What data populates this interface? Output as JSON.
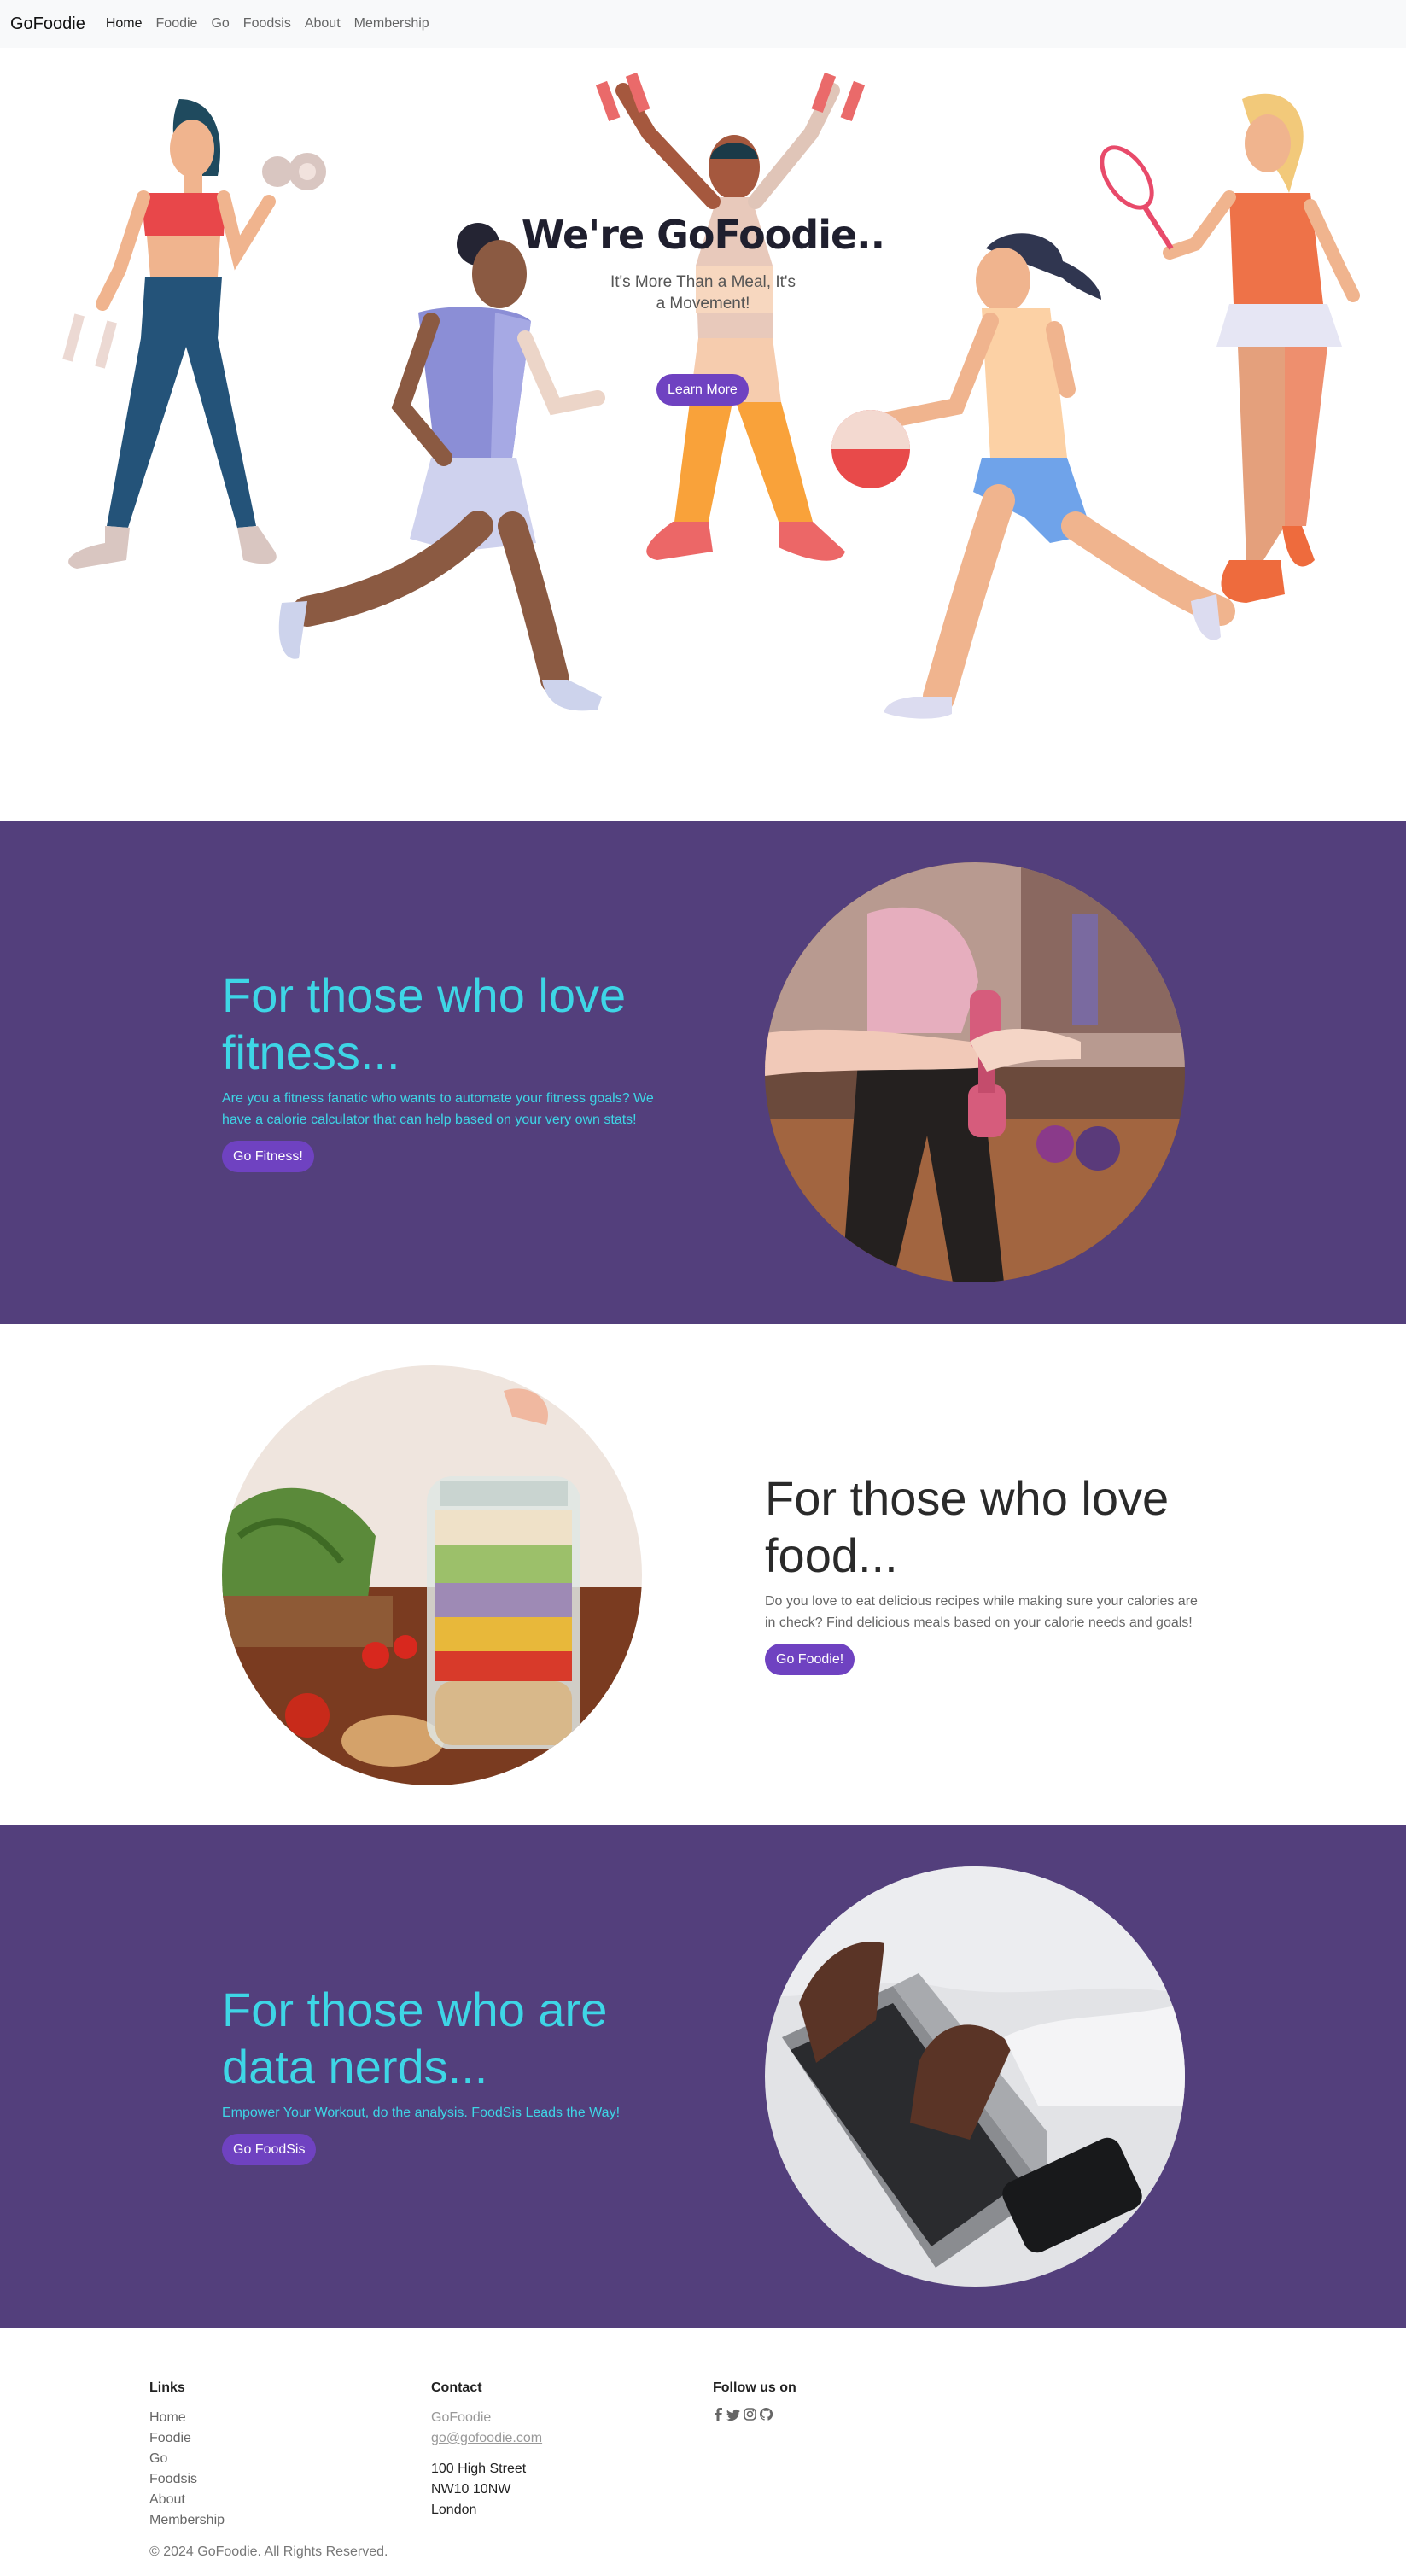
{
  "nav": {
    "brand": "GoFoodie",
    "links": [
      "Home",
      "Foodie",
      "Go",
      "Foodsis",
      "About",
      "Membership"
    ]
  },
  "hero": {
    "title": "We're GoFoodie..",
    "subtitle_line1": "It's More Than a Meal, It's",
    "subtitle_line2": "a Movement!",
    "button": "Learn More"
  },
  "sections": [
    {
      "title_line1": "For those who love",
      "title_line2": "fitness...",
      "desc_line1": "Are you a fitness fanatic who wants to automate your fitness goals? We",
      "desc_line2": "have a calorie calculator that can help based on your very own stats!",
      "button": "Go Fitness!"
    },
    {
      "title_line1": "For those who love",
      "title_line2": "food...",
      "desc_line1": "Do you love to eat delicious recipes while making sure your calories are",
      "desc_line2": "in check? Find delicious meals based on your calorie needs and goals!",
      "button": "Go Foodie!"
    },
    {
      "title_line1": "For those who are",
      "title_line2": "data nerds...",
      "desc_line1": "Empower Your Workout, do the analysis. FoodSis Leads the Way!",
      "desc_line2": "",
      "button": "Go FoodSis"
    }
  ],
  "footer": {
    "links_heading": "Links",
    "links": [
      "Home",
      "Foodie",
      "Go",
      "Foodsis",
      "About",
      "Membership"
    ],
    "contact_heading": "Contact",
    "contact_name": "GoFoodie",
    "contact_email": "go@gofoodie.com",
    "address": [
      "100 High Street",
      "NW10 10NW",
      "London"
    ],
    "follow_heading": "Follow us on",
    "social_icons": [
      "facebook-icon",
      "twitter-icon",
      "instagram-icon",
      "github-icon"
    ],
    "copyright": "© 2024 GoFoodie. All Rights Reserved."
  },
  "colors": {
    "purple_section": "#533f7c",
    "button": "#6f42c1",
    "accent_text": "#3ed6e6"
  }
}
